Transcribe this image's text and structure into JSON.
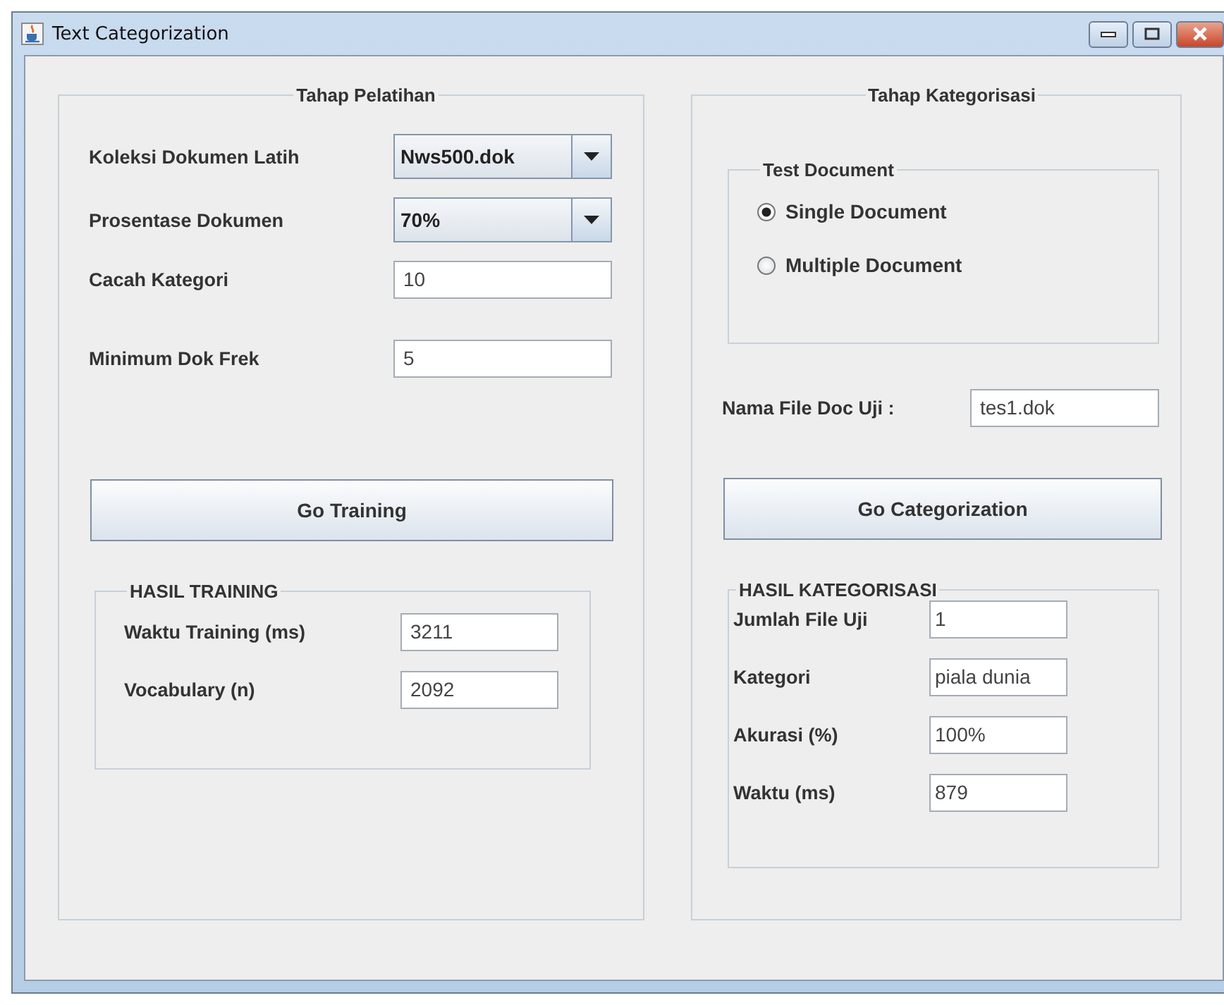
{
  "window": {
    "title": "Text Categorization"
  },
  "training": {
    "title": "Tahap Pelatihan",
    "fields": [
      {
        "kind": "dropdown",
        "label": "Koleksi Dokumen Latih",
        "value": "Nws500.dok"
      },
      {
        "kind": "dropdown",
        "label": "Prosentase Dokumen",
        "value": "70%"
      },
      {
        "kind": "text",
        "label": "Cacah Kategori",
        "value": "10"
      },
      {
        "kind": "text",
        "label": "Minimum Dok Frek",
        "value": "5"
      }
    ],
    "button": "Go Training",
    "results": {
      "title": "HASIL TRAINING",
      "fields": [
        {
          "label": "Waktu Training  (ms)",
          "value": "3211"
        },
        {
          "label": "Vocabulary (n)",
          "value": "2092"
        }
      ]
    }
  },
  "categorization": {
    "title": "Tahap Kategorisasi",
    "test_document": {
      "title": "Test Document",
      "options": [
        {
          "label": "Single Document",
          "selected": true
        },
        {
          "label": "Multiple Document",
          "selected": false
        }
      ]
    },
    "file_field": {
      "label": "Nama File Doc Uji :",
      "value": "tes1.dok"
    },
    "button": "Go Categorization",
    "results": {
      "title": "HASIL KATEGORISASI",
      "fields": [
        {
          "label": "Jumlah File Uji",
          "value": "1"
        },
        {
          "label": "Kategori",
          "value": "piala dunia"
        },
        {
          "label": "Akurasi (%)",
          "value": "100%"
        },
        {
          "label": "Waktu (ms)",
          "value": "879"
        }
      ]
    }
  }
}
